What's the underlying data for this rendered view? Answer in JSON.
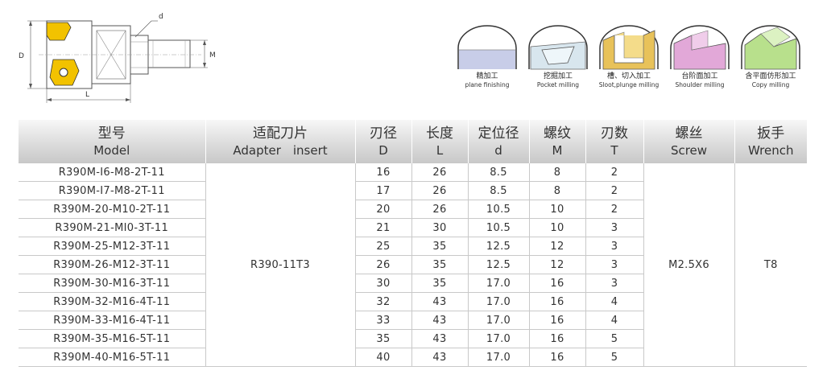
{
  "drawing": {
    "label_d_small": "d",
    "label_D": "D",
    "label_M": "M",
    "label_L": "L"
  },
  "operations": [
    {
      "cn": "精加工",
      "en": "plane finishing",
      "icon": "plane-finishing-icon"
    },
    {
      "cn": "挖掘加工",
      "en": "Pocket milling",
      "icon": "pocket-milling-icon"
    },
    {
      "cn": "槽、切入加工",
      "en": "Sloot,plunge milling",
      "icon": "slot-plunge-milling-icon"
    },
    {
      "cn": "台阶面加工",
      "en": "Shoulder milling",
      "icon": "shoulder-milling-icon"
    },
    {
      "cn": "含平面仿形加工",
      "en": "Copy milling",
      "icon": "copy-milling-icon"
    }
  ],
  "table": {
    "headers": [
      {
        "cn": "型号",
        "en": "Model"
      },
      {
        "cn": "适配刀片",
        "en": "Adapter　insert"
      },
      {
        "cn": "刃径",
        "en": "D"
      },
      {
        "cn": "长度",
        "en": "L"
      },
      {
        "cn": "定位径",
        "en": "d"
      },
      {
        "cn": "螺纹",
        "en": "M"
      },
      {
        "cn": "刃数",
        "en": "T"
      },
      {
        "cn": "螺丝",
        "en": "Screw"
      },
      {
        "cn": "扳手",
        "en": "Wrench"
      }
    ],
    "insert": "R390-11T3",
    "screw": "M2.5X6",
    "wrench": "T8",
    "rows": [
      {
        "model": "R390M-I6-M8-2T-11",
        "D": "16",
        "L": "26",
        "d": "8.5",
        "M": "8",
        "T": "2"
      },
      {
        "model": "R390M-I7-M8-2T-11",
        "D": "17",
        "L": "26",
        "d": "8.5",
        "M": "8",
        "T": "2"
      },
      {
        "model": "R390M-20-M10-2T-11",
        "D": "20",
        "L": "26",
        "d": "10.5",
        "M": "10",
        "T": "2"
      },
      {
        "model": "R390M-21-MI0-3T-11",
        "D": "21",
        "L": "30",
        "d": "10.5",
        "M": "10",
        "T": "3"
      },
      {
        "model": "R390M-25-M12-3T-11",
        "D": "25",
        "L": "35",
        "d": "12.5",
        "M": "12",
        "T": "3"
      },
      {
        "model": "R390M-26-M12-3T-11",
        "D": "26",
        "L": "35",
        "d": "12.5",
        "M": "12",
        "T": "3"
      },
      {
        "model": "R390M-30-M16-3T-11",
        "D": "30",
        "L": "35",
        "d": "17.0",
        "M": "16",
        "T": "3"
      },
      {
        "model": "R390M-32-M16-4T-11",
        "D": "32",
        "L": "43",
        "d": "17.0",
        "M": "16",
        "T": "4"
      },
      {
        "model": "R390M-33-M16-4T-11",
        "D": "33",
        "L": "43",
        "d": "17.0",
        "M": "16",
        "T": "4"
      },
      {
        "model": "R390M-35-M16-5T-11",
        "D": "35",
        "L": "43",
        "d": "17.0",
        "M": "16",
        "T": "5"
      },
      {
        "model": "R390M-40-M16-5T-11",
        "D": "40",
        "L": "43",
        "d": "17.0",
        "M": "16",
        "T": "5"
      }
    ]
  }
}
